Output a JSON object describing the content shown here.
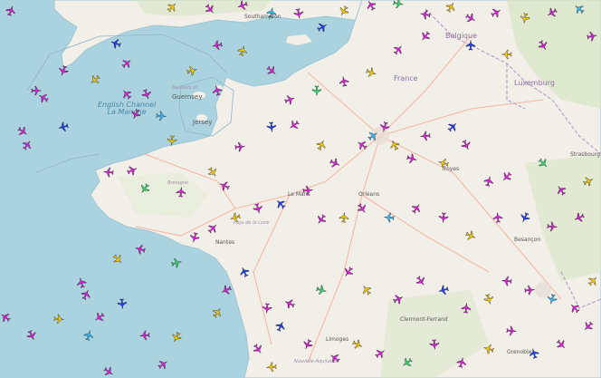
{
  "map": {
    "title": "",
    "colors": {
      "sea": "#aad3df",
      "land": "#f2efe9",
      "green": "#d6e5c3",
      "road": "#f4b7a6",
      "border": "#b9a3c4"
    },
    "labels": {
      "sea_en": "English Channel",
      "sea_fr": "La Manche",
      "guernsey": "Guernsey",
      "jersey": "Jersey",
      "bailiwick": "Bailiwick of",
      "belgium": "Belgique",
      "luxembourg": "Luxemburg",
      "france": "France",
      "southampton": "Southampton",
      "le_mans": "Le Mans",
      "orleans": "Orléans",
      "troyes": "Troyes",
      "nantes": "Nantes",
      "limoges": "Limoges",
      "clermont": "Clermont-Ferrand",
      "bretagne": "Bretagne",
      "pays_loire": "Pays de la Loire",
      "strasbourg": "Strasbourg",
      "besancon": "Besançon",
      "grenoble": "Grenoble",
      "nouvelle_aquitaine": "Nouvelle-Aquitaine"
    }
  },
  "planes": [
    {
      "c": "#e020e0",
      "r": 20
    },
    {
      "c": "#e020e0",
      "r": 200
    },
    {
      "c": "#e020e0",
      "r": 90
    },
    {
      "c": "#e020e0",
      "r": 300
    },
    {
      "c": "#ffd000",
      "r": 45
    },
    {
      "c": "#e020e0",
      "r": 140
    },
    {
      "c": "#e020e0",
      "r": 250
    },
    {
      "c": "#30c0ff",
      "r": 10
    },
    {
      "c": "#e020e0",
      "r": 170
    },
    {
      "c": "#2040ff",
      "r": 60
    },
    {
      "c": "#ffd000",
      "r": 210
    },
    {
      "c": "#e020e0",
      "r": 330
    },
    {
      "c": "#30e070",
      "r": 100
    },
    {
      "c": "#e020e0",
      "r": 280
    },
    {
      "c": "#ffd000",
      "r": 30
    },
    {
      "c": "#e020e0",
      "r": 120
    },
    {
      "c": "#e020e0",
      "r": 60
    },
    {
      "c": "#ffd000",
      "r": 190
    },
    {
      "c": "#e020e0",
      "r": 240
    },
    {
      "c": "#30c0ff",
      "r": 310
    },
    {
      "c": "#e020e0",
      "r": 80
    },
    {
      "c": "#e020e0",
      "r": 150
    },
    {
      "c": "#ffd000",
      "r": 270
    },
    {
      "c": "#2040ff",
      "r": 0
    },
    {
      "c": "#e020e0",
      "r": 220
    },
    {
      "c": "#e020e0",
      "r": 40
    },
    {
      "c": "#ffd000",
      "r": 110
    },
    {
      "c": "#e020e0",
      "r": 350
    },
    {
      "c": "#30e070",
      "r": 180
    },
    {
      "c": "#e020e0",
      "r": 70
    },
    {
      "c": "#e020e0",
      "r": 260
    },
    {
      "c": "#ffd000",
      "r": 15
    },
    {
      "c": "#e020e0",
      "r": 130
    },
    {
      "c": "#2040ff",
      "r": 290
    },
    {
      "c": "#e020e0",
      "r": 50
    },
    {
      "c": "#ffd000",
      "r": 230
    },
    {
      "c": "#e020e0",
      "r": 160
    },
    {
      "c": "#e020e0",
      "r": 320
    },
    {
      "c": "#30c0ff",
      "r": 95
    },
    {
      "c": "#e020e0",
      "r": 205
    },
    {
      "c": "#ffd000",
      "r": 75
    },
    {
      "c": "#e020e0",
      "r": 345
    },
    {
      "c": "#e020e0",
      "r": 125
    },
    {
      "c": "#2040ff",
      "r": 255
    },
    {
      "c": "#e020e0",
      "r": 35
    },
    {
      "c": "#ffd000",
      "r": 185
    },
    {
      "c": "#e020e0",
      "r": 275
    },
    {
      "c": "#e020e0",
      "r": 65
    },
    {
      "c": "#30e070",
      "r": 215
    },
    {
      "c": "#e020e0",
      "r": 5
    },
    {
      "c": "#ffd000",
      "r": 145
    },
    {
      "c": "#e020e0",
      "r": 295
    },
    {
      "c": "#e020e0",
      "r": 85
    },
    {
      "c": "#2040ff",
      "r": 175
    },
    {
      "c": "#e020e0",
      "r": 235
    },
    {
      "c": "#ffd000",
      "r": 25
    },
    {
      "c": "#e020e0",
      "r": 115
    },
    {
      "c": "#e020e0",
      "r": 305
    },
    {
      "c": "#30c0ff",
      "r": 55
    },
    {
      "c": "#e020e0",
      "r": 195
    },
    {
      "c": "#ffd000",
      "r": 335
    },
    {
      "c": "#e020e0",
      "r": 105
    },
    {
      "c": "#e020e0",
      "r": 265
    },
    {
      "c": "#2040ff",
      "r": 45
    },
    {
      "c": "#e020e0",
      "r": 155
    },
    {
      "c": "#ffd000",
      "r": 285
    },
    {
      "c": "#e020e0",
      "r": 15
    },
    {
      "c": "#e020e0",
      "r": 225
    },
    {
      "c": "#30e070",
      "r": 135
    },
    {
      "c": "#e020e0",
      "r": 325
    },
    {
      "c": "#ffd000",
      "r": 65
    },
    {
      "c": "#e020e0",
      "r": 245
    },
    {
      "c": "#e020e0",
      "r": 95
    },
    {
      "c": "#2040ff",
      "r": 205
    },
    {
      "c": "#e020e0",
      "r": 355
    },
    {
      "c": "#ffd000",
      "r": 115
    },
    {
      "c": "#e020e0",
      "r": 185
    },
    {
      "c": "#e020e0",
      "r": 35
    },
    {
      "c": "#30c0ff",
      "r": 275
    },
    {
      "c": "#e020e0",
      "r": 145
    },
    {
      "c": "#ffd000",
      "r": 5
    },
    {
      "c": "#e020e0",
      "r": 215
    },
    {
      "c": "#e020e0",
      "r": 85
    },
    {
      "c": "#2040ff",
      "r": 315
    },
    {
      "c": "#e020e0",
      "r": 165
    },
    {
      "c": "#ffd000",
      "r": 255
    },
    {
      "c": "#e020e0",
      "r": 45
    },
    {
      "c": "#e020e0",
      "r": 195
    },
    {
      "c": "#30e070",
      "r": 75
    },
    {
      "c": "#e020e0",
      "r": 285
    },
    {
      "c": "#ffd000",
      "r": 135
    },
    {
      "c": "#e020e0",
      "r": 345
    },
    {
      "c": "#e020e0",
      "r": 25
    },
    {
      "c": "#2040ff",
      "r": 175
    },
    {
      "c": "#e020e0",
      "r": 235
    },
    {
      "c": "#ffd000",
      "r": 95
    },
    {
      "c": "#e020e0",
      "r": 305
    },
    {
      "c": "#e020e0",
      "r": 155
    },
    {
      "c": "#30c0ff",
      "r": 15
    },
    {
      "c": "#e020e0",
      "r": 265
    },
    {
      "c": "#ffd000",
      "r": 205
    },
    {
      "c": "#e020e0",
      "r": 55
    },
    {
      "c": "#e020e0",
      "r": 125
    },
    {
      "c": "#2040ff",
      "r": 335
    },
    {
      "c": "#e020e0",
      "r": 245
    },
    {
      "c": "#ffd000",
      "r": 35
    },
    {
      "c": "#e020e0",
      "r": 185
    },
    {
      "c": "#e020e0",
      "r": 295
    },
    {
      "c": "#30e070",
      "r": 105
    },
    {
      "c": "#e020e0",
      "r": 215
    },
    {
      "c": "#ffd000",
      "r": 325
    },
    {
      "c": "#e020e0",
      "r": 65
    },
    {
      "c": "#e020e0",
      "r": 145
    },
    {
      "c": "#2040ff",
      "r": 255
    },
    {
      "c": "#e020e0",
      "r": 5
    },
    {
      "c": "#ffd000",
      "r": 165
    },
    {
      "c": "#e020e0",
      "r": 275
    },
    {
      "c": "#e020e0",
      "r": 85
    },
    {
      "c": "#30c0ff",
      "r": 195
    },
    {
      "c": "#e020e0",
      "r": 315
    },
    {
      "c": "#ffd000",
      "r": 45
    },
    {
      "c": "#e020e0",
      "r": 225
    },
    {
      "c": "#e020e0",
      "r": 135
    },
    {
      "c": "#2040ff",
      "r": 345
    },
    {
      "c": "#e020e0",
      "r": 95
    },
    {
      "c": "#ffd000",
      "r": 285
    },
    {
      "c": "#e020e0",
      "r": 15
    },
    {
      "c": "#e020e0",
      "r": 175
    },
    {
      "c": "#30e070",
      "r": 235
    },
    {
      "c": "#e020e0",
      "r": 55
    },
    {
      "c": "#ffd000",
      "r": 115
    },
    {
      "c": "#e020e0",
      "r": 305
    },
    {
      "c": "#e020e0",
      "r": 205
    },
    {
      "c": "#2040ff",
      "r": 25
    },
    {
      "c": "#e020e0",
      "r": 145
    },
    {
      "c": "#ffd000",
      "r": 265
    }
  ]
}
